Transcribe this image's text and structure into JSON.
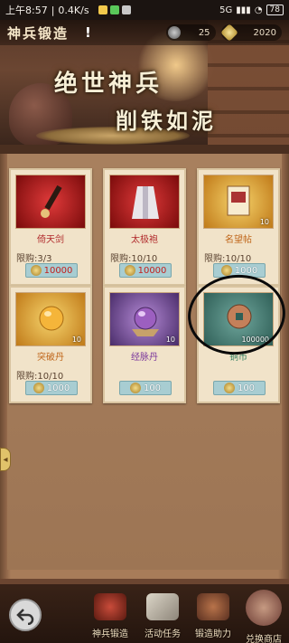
{
  "status_bar": {
    "time": "上午8:57",
    "speed": "0.4K/s",
    "signal": "5G",
    "battery": "78"
  },
  "header": {
    "title": "神兵锻造",
    "info_mark": "!",
    "resources": [
      {
        "icon": "ore-icon",
        "value": "25"
      },
      {
        "icon": "gold-ingot-icon",
        "value": "2020"
      }
    ],
    "slogan_line1": "绝世神兵",
    "slogan_line2": "削铁如泥"
  },
  "shop": {
    "side_tab_icon": "expand-icon",
    "items": [
      {
        "name": "倚天剑",
        "limit": "限购:3/3",
        "price": "10000",
        "quantity": "",
        "rarity": "red"
      },
      {
        "name": "太极袍",
        "limit": "限购:10/10",
        "price": "10000",
        "quantity": "",
        "rarity": "red"
      },
      {
        "name": "名望帖",
        "limit": "限购:10/10",
        "price": "1000",
        "quantity": "10",
        "rarity": "orange"
      },
      {
        "name": "突破丹",
        "limit": "限购:10/10",
        "price": "1000",
        "quantity": "10",
        "rarity": "orange"
      },
      {
        "name": "经脉丹",
        "limit": "",
        "price": "100",
        "quantity": "10",
        "rarity": "purple"
      },
      {
        "name": "铜币",
        "limit": "",
        "price": "100",
        "quantity": "100000",
        "rarity": "green"
      }
    ]
  },
  "bottom_nav": {
    "back_icon": "back-arrow-icon",
    "tabs": [
      {
        "label": "神兵锻造",
        "icon": "forge-icon",
        "active": false
      },
      {
        "label": "活动任务",
        "icon": "task-icon",
        "active": false
      },
      {
        "label": "锻造助力",
        "icon": "assist-icon",
        "active": false
      },
      {
        "label": "兑换商店",
        "icon": "exchange-shop-icon",
        "active": true
      }
    ]
  },
  "colors": {
    "price_red": "#c2201e",
    "price_bg": "#a8cdd2",
    "card_bg": "#f1e3c9",
    "wood": "#a87c59"
  }
}
